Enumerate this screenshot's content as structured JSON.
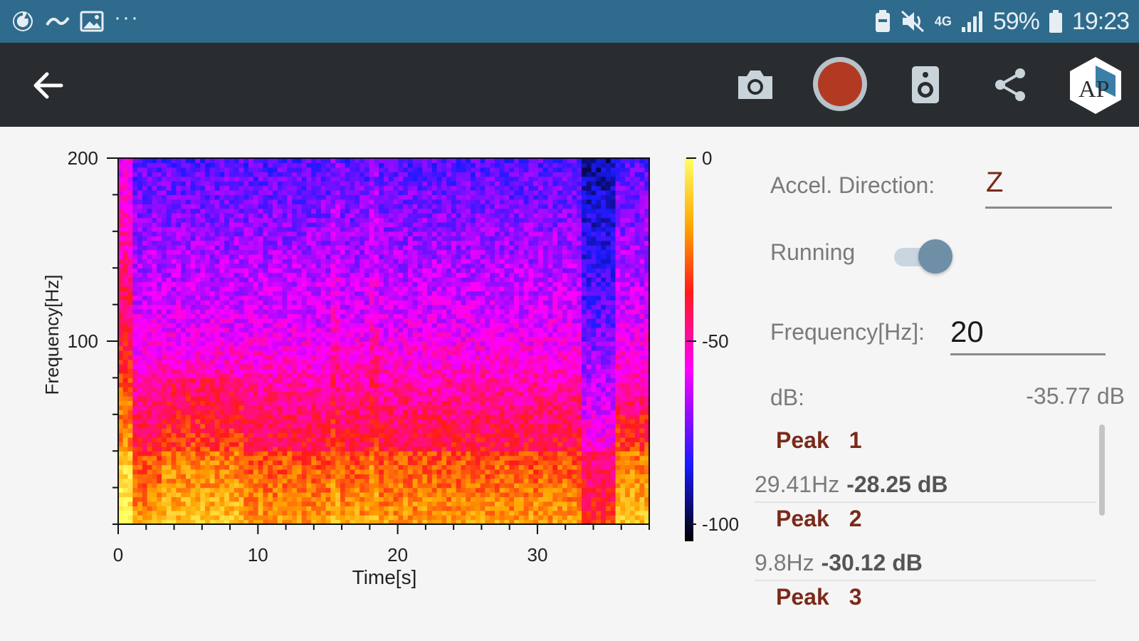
{
  "status_bar": {
    "battery": "59%",
    "time": "19:23",
    "network": "4G",
    "dots": "···"
  },
  "toolbar": {
    "logo_letters": "AP"
  },
  "colors": {
    "status_bar": "#2f6b8c",
    "toolbar": "#2a2d2f",
    "record": "#b23a22",
    "peak_title": "#7a2a1a"
  },
  "chart_data": {
    "type": "heatmap",
    "xlabel": "Time[s]",
    "ylabel": "Frequency[Hz]",
    "xlim": [
      0,
      38
    ],
    "ylim": [
      0,
      200
    ],
    "x_ticks": [
      0,
      10,
      20,
      30
    ],
    "y_ticks": [
      100,
      200
    ],
    "colorbar": {
      "min": -100,
      "max": 0,
      "ticks": [
        0,
        -50,
        -100
      ]
    },
    "colormap": [
      "#000000",
      "#1a1aff",
      "#ff00ff",
      "#ff1a1a",
      "#ffa500",
      "#ffff66"
    ]
  },
  "panel": {
    "accel_label": "Accel. Direction:",
    "accel_value": "Z",
    "running_label": "Running",
    "freq_label": "Frequency[Hz]:",
    "freq_value": "20",
    "db_label": "dB:",
    "db_value": "-35.77 dB",
    "peaks": [
      {
        "title": "Peak",
        "num": "1",
        "hz": "29.41Hz",
        "db": "-28.25 dB"
      },
      {
        "title": "Peak",
        "num": "2",
        "hz": "9.8Hz",
        "db": "-30.12 dB"
      },
      {
        "title": "Peak",
        "num": "3",
        "hz": "",
        "db": ""
      }
    ]
  }
}
